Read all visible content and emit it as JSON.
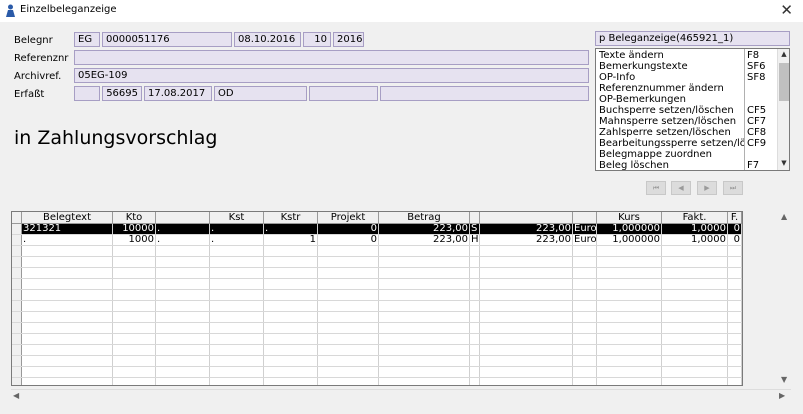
{
  "window": {
    "title": "Einzelbeleganzeige",
    "close_glyph": "✕"
  },
  "labels": {
    "belegnr": "Belegnr",
    "referenznr": "Referenznr",
    "archivref": "Archivref.",
    "erfasst": "Erfaßt"
  },
  "fields": {
    "beleg_art": "EG",
    "beleg_nr": "0000051176",
    "beleg_datum": "08.10.2016",
    "periode": "10",
    "jahr": "2016",
    "referenznr": "",
    "archivref": "05EG-109",
    "erfasst_nr": "56695",
    "erfasst_datum": "17.08.2017",
    "erfasst_user": "OD",
    "erfasst_extra1": "",
    "erfasst_extra2": ""
  },
  "status_text": "in Zahlungsvorschlag",
  "menu": {
    "header": "p Beleganzeige(465921_1)",
    "items": [
      {
        "label": "Texte ändern",
        "key": "F8"
      },
      {
        "label": "Bemerkungstexte",
        "key": "SF6"
      },
      {
        "label": "OP-Info",
        "key": "SF8"
      },
      {
        "label": "Referenznummer ändern",
        "key": ""
      },
      {
        "label": "OP-Bemerkungen",
        "key": ""
      },
      {
        "label": "Buchsperre setzen/löschen",
        "key": "CF5"
      },
      {
        "label": "Mahnsperre setzen/löschen",
        "key": "CF7"
      },
      {
        "label": "Zahlsperre setzen/löschen",
        "key": "CF8"
      },
      {
        "label": "Bearbeitungssperre setzen/lö",
        "key": "CF9"
      },
      {
        "label": "Belegmappe zuordnen",
        "key": ""
      },
      {
        "label": "Beleg löschen",
        "key": "F7"
      }
    ]
  },
  "nav_buttons": [
    "⏮",
    "◀",
    "▶",
    "⏭"
  ],
  "table": {
    "headers": [
      "Belegtext",
      "Kto",
      "",
      "Kst",
      "Kstr",
      "Projekt",
      "Betrag",
      "",
      "",
      "",
      "Kurs",
      "Fakt.",
      "F."
    ],
    "rows": [
      [
        "321321",
        "10000",
        ".",
        ".",
        ".",
        "0",
        "223,00",
        "S",
        "223,00",
        "Euro",
        "1,000000",
        "1,0000",
        "0"
      ],
      [
        ".",
        "1000",
        ".",
        ".",
        "1",
        "0",
        "223,00",
        "H",
        "223,00",
        "Euro",
        "1,000000",
        "1,0000",
        "0"
      ]
    ],
    "empty_rows": 13
  },
  "colors": {
    "field_bg": "#e6e2f0",
    "field_border": "#a79ec4",
    "selected_row": "#000000"
  }
}
